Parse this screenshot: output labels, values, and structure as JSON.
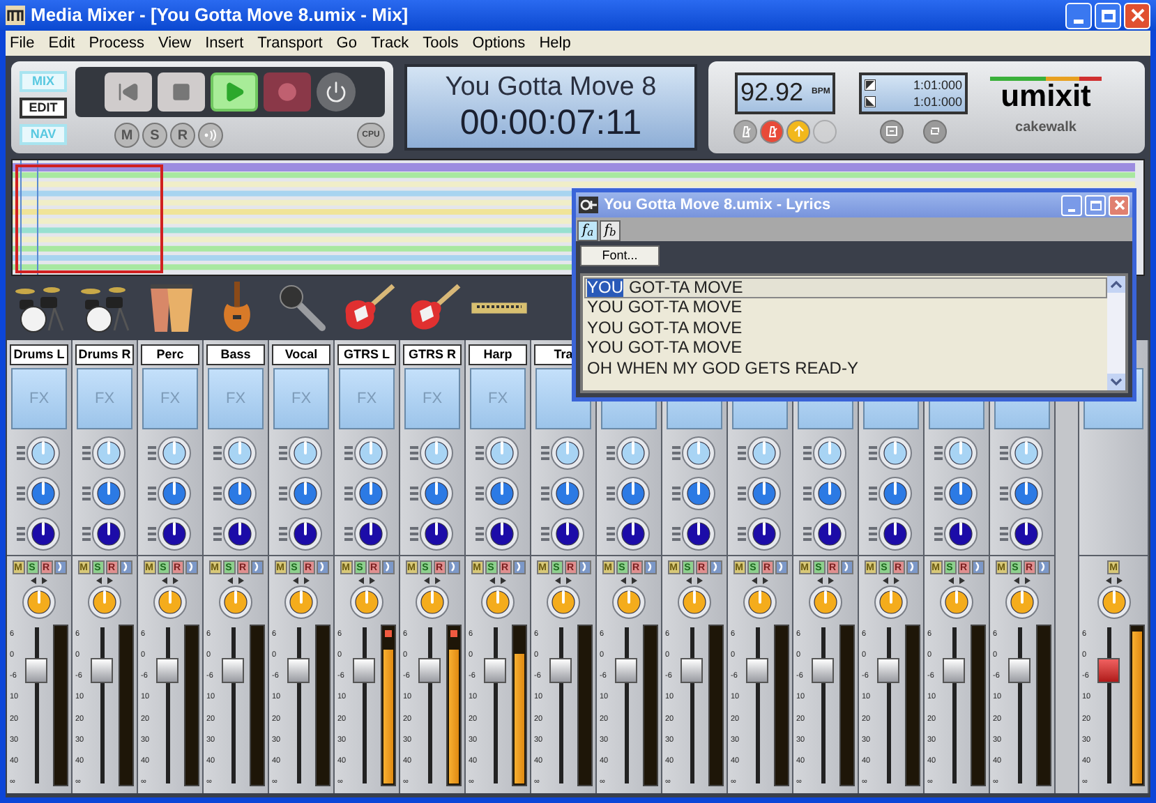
{
  "window": {
    "title": "Media Mixer - [You Gotta Move 8.umix - Mix]"
  },
  "menu": [
    "File",
    "Edit",
    "Process",
    "View",
    "Insert",
    "Transport",
    "Go",
    "Track",
    "Tools",
    "Options",
    "Help"
  ],
  "modes": [
    {
      "label": "MIX",
      "on": true
    },
    {
      "label": "EDIT",
      "on": false
    },
    {
      "label": "NAV",
      "on": true
    }
  ],
  "transport": [
    {
      "kind": "rewind",
      "active": false
    },
    {
      "kind": "stop",
      "active": false
    },
    {
      "kind": "play",
      "active": true
    },
    {
      "kind": "record",
      "active": false
    },
    {
      "kind": "power",
      "active": false
    }
  ],
  "transport_small": [
    {
      "kind": "text",
      "label": "M"
    },
    {
      "kind": "text",
      "label": "S"
    },
    {
      "kind": "text",
      "label": "R"
    },
    {
      "kind": "monitor"
    }
  ],
  "cpu": "CPU",
  "display": {
    "song": "You Gotta Move 8",
    "time": "00:00:07:11"
  },
  "tempo": {
    "value": "92.92",
    "unit": "BPM"
  },
  "tempo_buttons": [
    {
      "kind": "metronome",
      "color": "#a8a8a8",
      "disabled": false
    },
    {
      "kind": "metronome",
      "color": "#e84a38",
      "disabled": false
    },
    {
      "kind": "arrow",
      "color": "#f2b81c",
      "disabled": false
    },
    {
      "kind": "blank",
      "color": "#d4d4d4",
      "disabled": true
    }
  ],
  "locators": [
    {
      "kind": "start",
      "time": "1:01:000"
    },
    {
      "kind": "end",
      "time": "1:01:000"
    }
  ],
  "locator_buttons": [
    {
      "kind": "fit"
    },
    {
      "kind": "loop"
    }
  ],
  "logo": {
    "name": "umixit",
    "vendor": "cakewalk"
  },
  "channels": [
    {
      "kind": "channel",
      "name": "Drums L",
      "fx": "FX",
      "msr": [
        "M",
        "S",
        "R"
      ],
      "scale": [
        "6",
        "0",
        "-6",
        "10",
        "20",
        "30",
        "40",
        "∞"
      ],
      "level": 0,
      "clip": false
    },
    {
      "kind": "channel",
      "name": "Drums R",
      "fx": "FX",
      "msr": [
        "M",
        "S",
        "R"
      ],
      "scale": [
        "6",
        "0",
        "-6",
        "10",
        "20",
        "30",
        "40",
        "∞"
      ],
      "level": 0,
      "clip": false
    },
    {
      "kind": "channel",
      "name": "Perc",
      "fx": "FX",
      "msr": [
        "M",
        "S",
        "R"
      ],
      "scale": [
        "6",
        "0",
        "-6",
        "10",
        "20",
        "30",
        "40",
        "∞"
      ],
      "level": 0,
      "clip": false
    },
    {
      "kind": "channel",
      "name": "Bass",
      "fx": "FX",
      "msr": [
        "M",
        "S",
        "R"
      ],
      "scale": [
        "6",
        "0",
        "-6",
        "10",
        "20",
        "30",
        "40",
        "∞"
      ],
      "level": 0,
      "clip": false
    },
    {
      "kind": "channel",
      "name": "Vocal",
      "fx": "FX",
      "msr": [
        "M",
        "S",
        "R"
      ],
      "scale": [
        "6",
        "0",
        "-6",
        "10",
        "20",
        "30",
        "40",
        "∞"
      ],
      "level": 0,
      "clip": false
    },
    {
      "kind": "channel",
      "name": "GTRS L",
      "fx": "FX",
      "msr": [
        "M",
        "S",
        "R"
      ],
      "scale": [
        "6",
        "0",
        "-6",
        "10",
        "20",
        "30",
        "40",
        "∞"
      ],
      "level": 0.86,
      "clip": true
    },
    {
      "kind": "channel",
      "name": "GTRS R",
      "fx": "FX",
      "msr": [
        "M",
        "S",
        "R"
      ],
      "scale": [
        "6",
        "0",
        "-6",
        "10",
        "20",
        "30",
        "40",
        "∞"
      ],
      "level": 0.86,
      "clip": true
    },
    {
      "kind": "channel",
      "name": "Harp",
      "fx": "FX",
      "msr": [
        "M",
        "S",
        "R"
      ],
      "scale": [
        "6",
        "0",
        "-6",
        "10",
        "20",
        "30",
        "40",
        "∞"
      ],
      "level": 0.83,
      "clip": false
    },
    {
      "kind": "channel",
      "name": "Tra",
      "msr": [
        "M",
        "S",
        "R"
      ],
      "scale": [
        "6",
        "0",
        "-6",
        "10",
        "20",
        "30",
        "40",
        "∞"
      ],
      "level": 0,
      "clip": false
    },
    {
      "kind": "channel",
      "msr": [
        "M",
        "S",
        "R"
      ],
      "scale": [
        "6",
        "0",
        "-6",
        "10",
        "20",
        "30",
        "40",
        "∞"
      ],
      "level": 0,
      "clip": false
    },
    {
      "kind": "channel",
      "msr": [
        "M",
        "S",
        "R"
      ],
      "scale": [
        "6",
        "0",
        "-6",
        "10",
        "20",
        "30",
        "40",
        "∞"
      ],
      "level": 0,
      "clip": false
    },
    {
      "kind": "channel",
      "msr": [
        "M",
        "S",
        "R"
      ],
      "scale": [
        "6",
        "0",
        "-6",
        "10",
        "20",
        "30",
        "40",
        "∞"
      ],
      "level": 0,
      "clip": false
    },
    {
      "kind": "channel",
      "msr": [
        "M",
        "S",
        "R"
      ],
      "scale": [
        "6",
        "0",
        "-6",
        "10",
        "20",
        "30",
        "40",
        "∞"
      ],
      "level": 0,
      "clip": false
    },
    {
      "kind": "channel",
      "msr": [
        "M",
        "S",
        "R"
      ],
      "scale": [
        "6",
        "0",
        "-6",
        "10",
        "20",
        "30",
        "40",
        "∞"
      ],
      "level": 0,
      "clip": false
    },
    {
      "kind": "channel",
      "msr": [
        "M",
        "S",
        "R"
      ],
      "scale": [
        "6",
        "0",
        "-6",
        "10",
        "20",
        "30",
        "40",
        "∞"
      ],
      "level": 0,
      "clip": false
    },
    {
      "kind": "channel",
      "msr": [
        "M",
        "S",
        "R"
      ],
      "scale": [
        "6",
        "0",
        "-6",
        "10",
        "20",
        "30",
        "40",
        "∞"
      ],
      "level": 0,
      "clip": false
    },
    {
      "kind": "master",
      "msr": [
        "M"
      ],
      "scale": [
        "6",
        "0",
        "-6",
        "10",
        "20",
        "30",
        "40",
        "∞"
      ],
      "level": 0.97,
      "clip": false
    }
  ],
  "lyrics_window": {
    "title": "You Gotta Move 8.umix - Lyrics",
    "tabs": [
      {
        "label": "f$_{a}$",
        "selected": true
      },
      {
        "label": "f$_{b}$",
        "selected": false
      }
    ],
    "font_button": "Font...",
    "lines": [
      {
        "current": true,
        "words": [
          {
            "text": "YOU",
            "selected": true
          },
          {
            "text": "GOT-TA MOVE",
            "selected": false
          }
        ]
      },
      {
        "current": false,
        "words": [
          {
            "text": "YOU GOT-TA MOVE",
            "selected": false
          }
        ]
      },
      {
        "current": false,
        "words": [
          {
            "text": "YOU GOT-TA MOVE",
            "selected": false
          }
        ]
      },
      {
        "current": false,
        "words": [
          {
            "text": "YOU GOT-TA MOVE",
            "selected": false
          }
        ]
      },
      {
        "current": false,
        "words": [
          {
            "text": "OH WHEN MY GOD GETS READ-Y",
            "selected": false
          }
        ]
      }
    ]
  }
}
